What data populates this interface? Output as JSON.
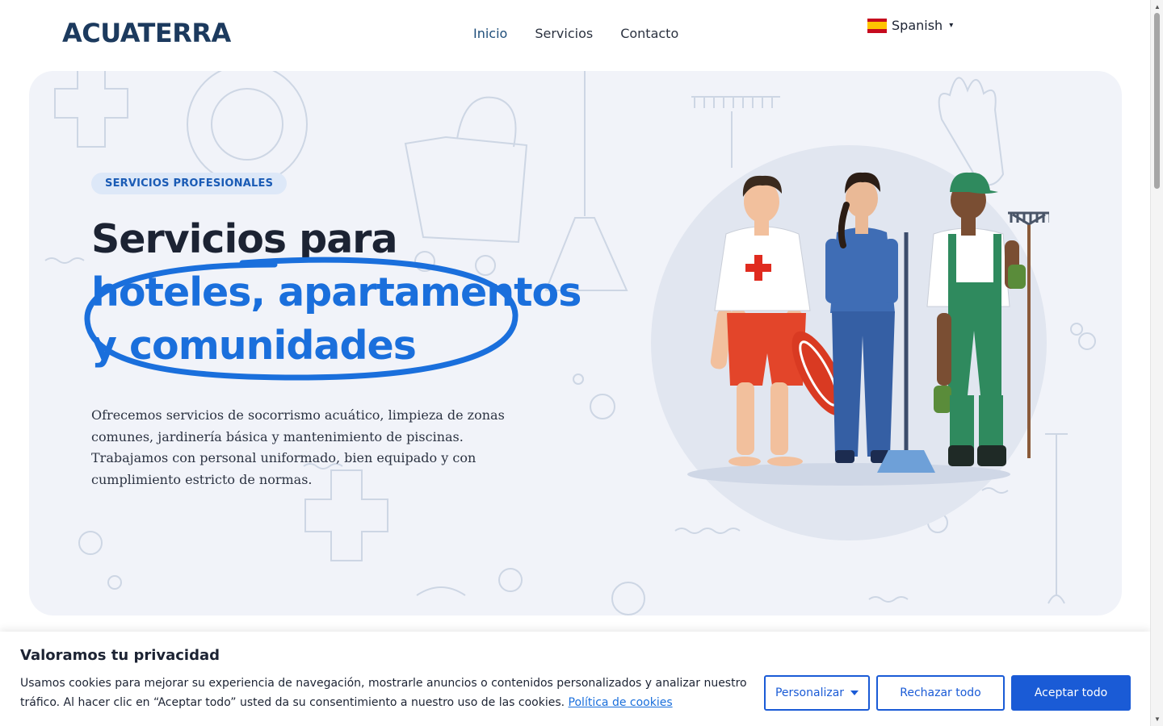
{
  "header": {
    "logo": "ACUATERRA",
    "nav": [
      {
        "label": "Inicio",
        "active": true
      },
      {
        "label": "Servicios",
        "active": false
      },
      {
        "label": "Contacto",
        "active": false
      }
    ],
    "language": {
      "label": "Spanish",
      "flag": "spain-flag-icon",
      "caret": "▾"
    }
  },
  "hero": {
    "badge": "SERVICIOS PROFESIONALES",
    "headline": {
      "line1": "Servicios para",
      "line2": "hoteles, apartamentos",
      "line3": "y comunidades"
    },
    "description": "Ofrecemos servicios de socorrismo acuático, limpieza de zonas comunes, jardinería básica y mantenimiento de piscinas. Trabajamos con personal uniformado, bien equipado y con cumplimiento estricto de normas.",
    "illustration": "lifeguard-cleaner-gardener-illustration"
  },
  "cookie_banner": {
    "title": "Valoramos tu privacidad",
    "text": "Usamos cookies para mejorar su experiencia de navegación, mostrarle anuncios o contenidos personalizados y analizar nuestro tráfico. Al hacer clic en “Aceptar todo” usted da su consentimiento a nuestro uso de las cookies.",
    "link_label": "Política de cookies",
    "buttons": {
      "customize": "Personalizar",
      "reject": "Rechazar todo",
      "accept": "Aceptar todo"
    }
  },
  "colors": {
    "brand_dark": "#1c3a5e",
    "accent_blue": "#1a6fdc",
    "button_blue": "#1a5bd6",
    "hero_bg": "#f1f3f9"
  }
}
